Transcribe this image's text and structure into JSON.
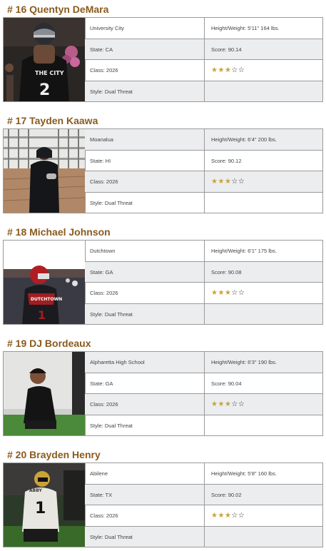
{
  "players": [
    {
      "name": "# 16 Quentyn DeMara",
      "school": "University City",
      "state": "State: CA",
      "class": "Class: 2026",
      "style": "Style: Dual Threat",
      "hw": "Height/Weight: 5'11\"  164 lbs.",
      "score": "Score: 90.14",
      "stars": 3,
      "stars_max": 5
    },
    {
      "name": "# 17 Tayden Kaawa",
      "school": "Moanalua",
      "state": "State: HI",
      "class": "Class: 2026",
      "style": "Style: Dual Threat",
      "hw": "Height/Weight: 6'4\"  200 lbs.",
      "score": "Score: 90.12",
      "stars": 3,
      "stars_max": 5
    },
    {
      "name": "# 18 Michael Johnson",
      "school": "Dutchtown",
      "state": "State: GA",
      "class": "Class: 2026",
      "style": "Style: Dual Threat",
      "hw": "Height/Weight: 6'1\"  175 lbs.",
      "score": "Score: 90.08",
      "stars": 3,
      "stars_max": 5
    },
    {
      "name": "# 19 DJ Bordeaux",
      "school": "Alpharetta High School",
      "state": "State: GA",
      "class": "Class: 2026",
      "style": "Style: Dual Threat",
      "hw": "Height/Weight: 6'3\"  190 lbs.",
      "score": "Score: 90.04",
      "stars": 3,
      "stars_max": 5
    },
    {
      "name": "# 20 Brayden Henry",
      "school": "Abilene",
      "state": "State: TX",
      "class": "Class: 2026",
      "style": "Style: Dual Threat",
      "hw": "Height/Weight: 5'8\"  160 lbs.",
      "score": "Score: 90.02",
      "stars": 3,
      "stars_max": 5
    }
  ],
  "colors": {
    "name": "#8a5a1e",
    "star_on": "#c9a23a",
    "shade": "#ecedef",
    "border": "#9a9a9a"
  },
  "icons": {
    "star_filled": "star-filled-icon",
    "star_empty": "star-empty-icon"
  }
}
